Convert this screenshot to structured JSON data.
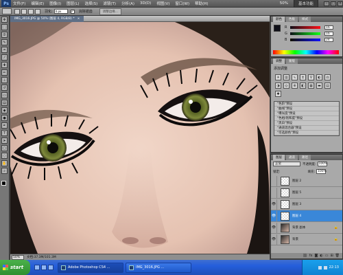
{
  "menu": {
    "app_logo": "Ps",
    "items": [
      "文件(F)",
      "编辑(E)",
      "图像(I)",
      "图层(L)",
      "选择(S)",
      "滤镜(T)",
      "分析(A)",
      "3D(D)",
      "视图(V)",
      "窗口(W)",
      "帮助(H)"
    ],
    "zoom": "50%",
    "workspace": "基本功能"
  },
  "options": {
    "feather_label": "羽化:",
    "feather_value": "0 px",
    "antialias_label": "消除锯齿",
    "refine_edge_label": "调整边缘..."
  },
  "document": {
    "tab_title": "IMG_3016.JPG @ 50% (图层 4, RGB/8) *",
    "zoom": "50%",
    "doc_info": "文档:37.3M/101.3M"
  },
  "color_panel": {
    "tabs": [
      "颜色",
      "色板",
      "样式"
    ],
    "sliders": [
      {
        "label": "R",
        "value": "16",
        "color": "#e04040"
      },
      {
        "label": "G",
        "value": "16",
        "color": "#40c040"
      },
      {
        "label": "B",
        "value": "24",
        "color": "#4060e0"
      }
    ]
  },
  "adjustments_panel": {
    "tabs": [
      "调整",
      "蒙版"
    ],
    "heading": "添加调整",
    "icons": [
      "brightness-icon",
      "levels-icon",
      "curves-icon",
      "exposure-icon",
      "vibrance-icon",
      "hue-icon",
      "balance-icon",
      "bw-icon",
      "photo-filter-icon",
      "mixer-icon",
      "invert-icon",
      "posterize-icon",
      "threshold-icon",
      "gradient-map-icon",
      "selective-color-icon"
    ],
    "presets": [
      "\"色阶\"预设",
      "\"曲线\"预设",
      "\"曝光度\"预设",
      "\"色相/饱和度\"预设",
      "\"黑白\"预设",
      "\"通道混合器\"预设",
      "\"可选颜色\"预设"
    ]
  },
  "layers_panel": {
    "tabs": [
      "图层",
      "通道",
      "路径"
    ],
    "blend_mode": "正常",
    "opacity_label": "不透明度:",
    "opacity_value": "100%",
    "lock_label": "锁定:",
    "fill_label": "填充:",
    "fill_value": "100%",
    "layers": [
      {
        "name": "图层 2",
        "thumb": "transparent",
        "selected": false,
        "lock": ""
      },
      {
        "name": "图层 5",
        "thumb": "transparent",
        "selected": false,
        "lock": ""
      },
      {
        "name": "图层 3",
        "thumb": "transparent",
        "selected": false,
        "lock": ""
      },
      {
        "name": "图层 4",
        "thumb": "transparent",
        "selected": true,
        "lock": ""
      },
      {
        "name": "背景 副本",
        "thumb": "image",
        "selected": false,
        "lock": "🔒"
      },
      {
        "name": "背景",
        "thumb": "image",
        "selected": false,
        "lock": "🔒"
      }
    ]
  },
  "taskbar": {
    "start_label": "start",
    "tasks": [
      "Adobe Photoshop CS4 ...",
      "IMG_3016.JPG ..."
    ],
    "clock": "22:13"
  }
}
